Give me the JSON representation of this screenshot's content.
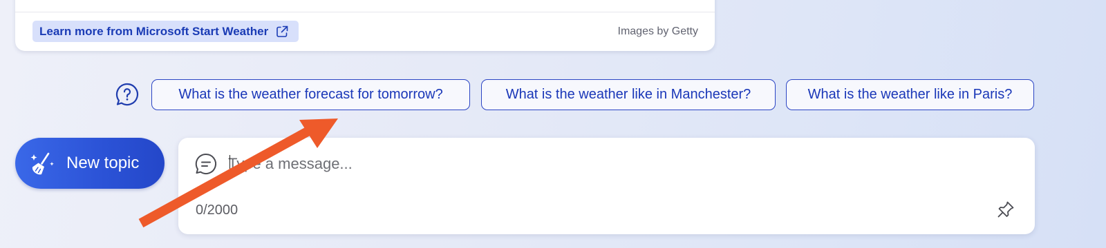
{
  "weather_card": {
    "learn_more_label": "Learn more from Microsoft Start Weather",
    "learn_more_icon": "external-link-icon",
    "images_credit": "Images by Getty"
  },
  "suggestions": {
    "icon": "question-bubble-icon",
    "items": [
      {
        "label": "What is the weather forecast for tomorrow?"
      },
      {
        "label": "What is the weather like in Manchester?"
      },
      {
        "label": "What is the weather like in Paris?"
      }
    ]
  },
  "new_topic": {
    "label": "New topic",
    "icon": "broom-sparkle-icon"
  },
  "composer": {
    "placeholder": "Type a message...",
    "value": "",
    "char_count": "0/2000",
    "chat_icon": "chat-bubble-icon",
    "pin_icon": "pin-icon"
  },
  "annotation": {
    "arrow_color": "#ee5a2a"
  },
  "colors": {
    "accent": "#2b52d6",
    "link": "#1a3bb5",
    "chip_border": "#2a44c4"
  }
}
